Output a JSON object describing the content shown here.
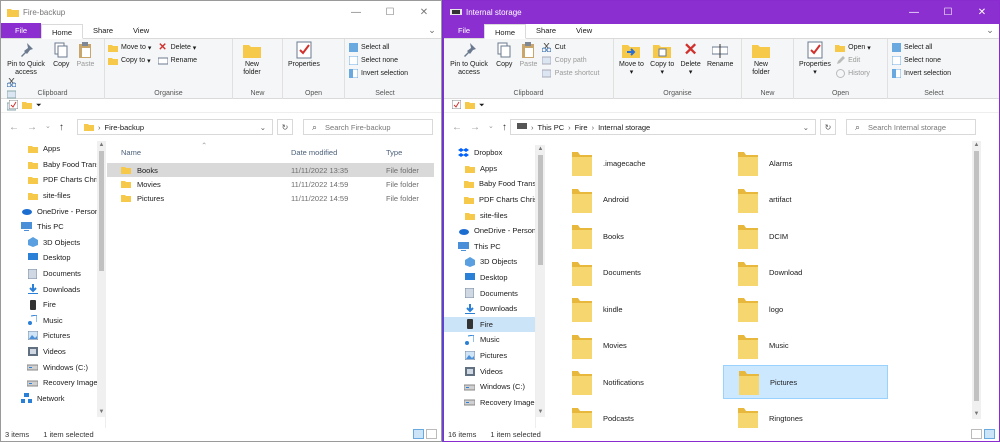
{
  "colors": {
    "accent": "#8b2fd1",
    "folder": "#f6c94b",
    "selection": "#cce8ff"
  },
  "win1": {
    "title": "Fire-backup",
    "tabs": [
      "File",
      "Home",
      "Share",
      "View"
    ],
    "ribbon": {
      "pin": "Pin to Quick access",
      "copy": "Copy",
      "paste": "Paste",
      "move_to": "Move to",
      "copy_to": "Copy to",
      "delete": "Delete",
      "rename": "Rename",
      "new_folder": "New folder",
      "properties": "Properties",
      "select_all": "Select all",
      "select_none": "Select none",
      "invert": "Invert selection",
      "groups": {
        "clipboard": "Clipboard",
        "organise": "Organise",
        "new": "New",
        "open": "Open",
        "select": "Select"
      }
    },
    "address": {
      "path": "Fire-backup",
      "search_placeholder": "Search Fire-backup"
    },
    "nav": [
      {
        "label": "Apps",
        "icon": "folder-icon"
      },
      {
        "label": "Baby Food Trans",
        "icon": "folder-icon"
      },
      {
        "label": "PDF Charts Chris",
        "icon": "folder-icon"
      },
      {
        "label": "site-files",
        "icon": "folder-icon"
      },
      {
        "label": "OneDrive - Person",
        "icon": "onedrive-icon"
      },
      {
        "label": "This PC",
        "icon": "pc-icon"
      },
      {
        "label": "3D Objects",
        "icon": "3d-objects-icon"
      },
      {
        "label": "Desktop",
        "icon": "desktop-icon"
      },
      {
        "label": "Documents",
        "icon": "documents-icon"
      },
      {
        "label": "Downloads",
        "icon": "downloads-icon"
      },
      {
        "label": "Fire",
        "icon": "device-icon"
      },
      {
        "label": "Music",
        "icon": "music-icon"
      },
      {
        "label": "Pictures",
        "icon": "pictures-icon"
      },
      {
        "label": "Videos",
        "icon": "videos-icon"
      },
      {
        "label": "Windows (C:)",
        "icon": "drive-icon"
      },
      {
        "label": "Recovery Image",
        "icon": "drive-icon"
      },
      {
        "label": "Network",
        "icon": "network-icon"
      }
    ],
    "columns": {
      "name": "Name",
      "date": "Date modified",
      "type": "Type"
    },
    "files": [
      {
        "name": "Books",
        "date": "11/11/2022 13:35",
        "type": "File folder"
      },
      {
        "name": "Movies",
        "date": "11/11/2022 14:59",
        "type": "File folder"
      },
      {
        "name": "Pictures",
        "date": "11/11/2022 14:59",
        "type": "File folder"
      }
    ],
    "status": {
      "items": "3 items",
      "selected": "1 item selected"
    }
  },
  "win2": {
    "title": "Internal storage",
    "tabs": [
      "File",
      "Home",
      "Share",
      "View"
    ],
    "ribbon": {
      "pin": "Pin to Quick access",
      "copy": "Copy",
      "paste": "Paste",
      "cut": "Cut",
      "copy_path": "Copy path",
      "paste_shortcut": "Paste shortcut",
      "move_to": "Move to",
      "copy_to": "Copy to",
      "delete": "Delete",
      "rename": "Rename",
      "new_folder": "New folder",
      "properties": "Properties",
      "open": "Open",
      "edit": "Edit",
      "history": "History",
      "select_all": "Select all",
      "select_none": "Select none",
      "invert": "Invert selection",
      "groups": {
        "clipboard": "Clipboard",
        "organise": "Organise",
        "new": "New",
        "open": "Open",
        "select": "Select"
      }
    },
    "address": {
      "crumbs": [
        "This PC",
        "Fire",
        "Internal storage"
      ],
      "search_placeholder": "Search Internal storage"
    },
    "nav": [
      {
        "label": "Dropbox",
        "icon": "dropbox-icon"
      },
      {
        "label": "Apps",
        "icon": "folder-icon"
      },
      {
        "label": "Baby Food Trans",
        "icon": "folder-icon"
      },
      {
        "label": "PDF Charts Chris",
        "icon": "folder-icon"
      },
      {
        "label": "site-files",
        "icon": "folder-icon"
      },
      {
        "label": "OneDrive - Person",
        "icon": "onedrive-icon"
      },
      {
        "label": "This PC",
        "icon": "pc-icon"
      },
      {
        "label": "3D Objects",
        "icon": "3d-objects-icon"
      },
      {
        "label": "Desktop",
        "icon": "desktop-icon"
      },
      {
        "label": "Documents",
        "icon": "documents-icon"
      },
      {
        "label": "Downloads",
        "icon": "downloads-icon"
      },
      {
        "label": "Fire",
        "icon": "device-icon"
      },
      {
        "label": "Music",
        "icon": "music-icon"
      },
      {
        "label": "Pictures",
        "icon": "pictures-icon"
      },
      {
        "label": "Videos",
        "icon": "videos-icon"
      },
      {
        "label": "Windows (C:)",
        "icon": "drive-icon"
      },
      {
        "label": "Recovery Image",
        "icon": "drive-icon"
      }
    ],
    "folders": [
      ".imagecache",
      "Alarms",
      "Android",
      "artifact",
      "Books",
      "DCIM",
      "Documents",
      "Download",
      "kindle",
      "logo",
      "Movies",
      "Music",
      "Notifications",
      "Pictures",
      "Podcasts",
      "Ringtones"
    ],
    "status": {
      "items": "16 items",
      "selected": "1 item selected"
    }
  }
}
